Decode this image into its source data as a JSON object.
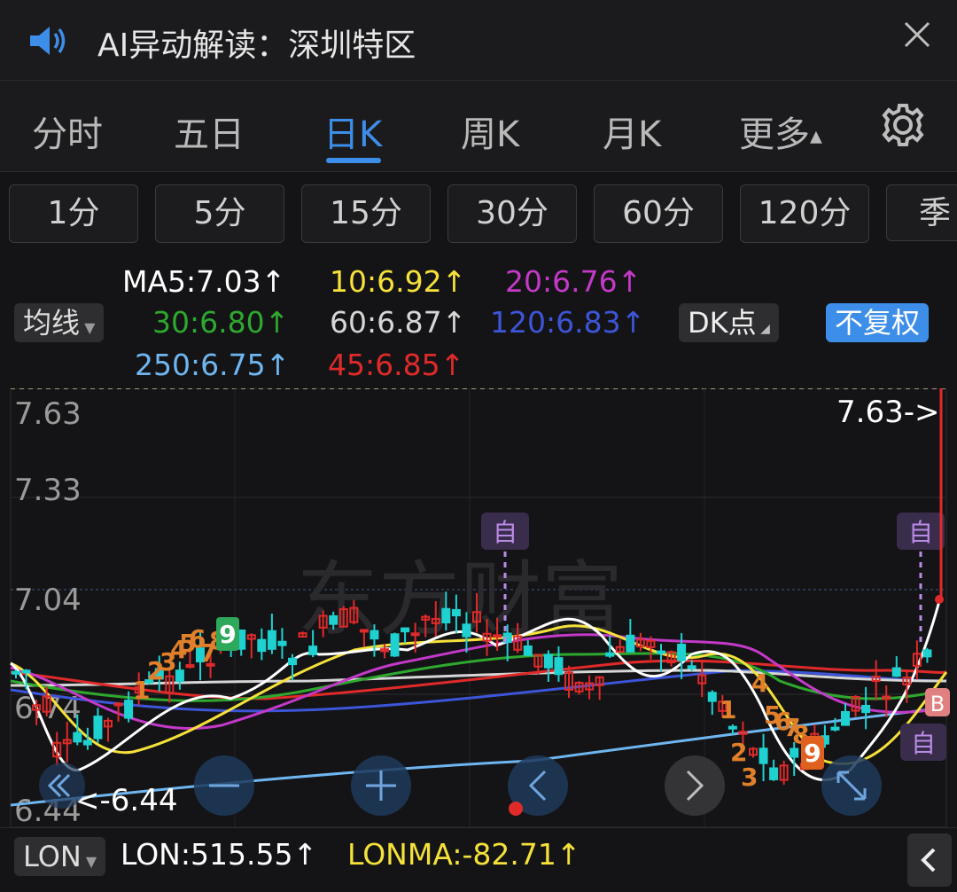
{
  "header": {
    "title": "AI异动解读：深圳特区",
    "speaker_icon": "speaker-icon",
    "close_icon": "close-icon"
  },
  "tabs": [
    {
      "label": "分时",
      "active": false
    },
    {
      "label": "五日",
      "active": false
    },
    {
      "label": "日K",
      "active": true
    },
    {
      "label": "周K",
      "active": false
    },
    {
      "label": "月K",
      "active": false
    },
    {
      "label": "更多",
      "active": false
    }
  ],
  "periods": [
    "1分",
    "5分",
    "15分",
    "30分",
    "60分",
    "120分",
    "季"
  ],
  "indicators": {
    "ma_selector": "均线",
    "ma_values": [
      {
        "label": "MA5:7.03↑",
        "color": "#ffffff"
      },
      {
        "label": "10:6.92↑",
        "color": "#f5e13a"
      },
      {
        "label": "20:6.76↑",
        "color": "#c339c8"
      },
      {
        "label": "30:6.80↑",
        "color": "#2ea82e"
      },
      {
        "label": "60:6.87↑",
        "color": "#d6d6d6"
      },
      {
        "label": "120:6.83↑",
        "color": "#3d55d8"
      },
      {
        "label": "250:6.75↑",
        "color": "#6fb6f0"
      },
      {
        "label": "45:6.85↑",
        "color": "#e02a2a"
      }
    ],
    "dk_button": "DK点",
    "fq_button": "不复权"
  },
  "chart": {
    "y_labels": [
      "7.63",
      "7.33",
      "7.04",
      "6.74",
      "6.44"
    ],
    "high_label": "7.63->",
    "low_label": "<-6.44",
    "marker_self": "自",
    "marker_b": "B",
    "watermark": "东方财富",
    "seq_left": [
      "1",
      "2",
      "3",
      "4",
      "5",
      "6",
      "7",
      "8",
      "9"
    ],
    "seq_right": [
      "1",
      "2",
      "3",
      "4",
      "5",
      "6",
      "7",
      "8",
      "9"
    ]
  },
  "bottom": {
    "indicator_selector": "LON",
    "lon_value": "LON:515.55↑",
    "lonma_value": "LONMA:-82.71↑",
    "collapse_icon": "chevron-left-icon"
  },
  "colors": {
    "accent": "#3d8ee8",
    "rise": "#e02a2a",
    "fall": "#1fd1d1",
    "self_marker": "#b98be6"
  }
}
